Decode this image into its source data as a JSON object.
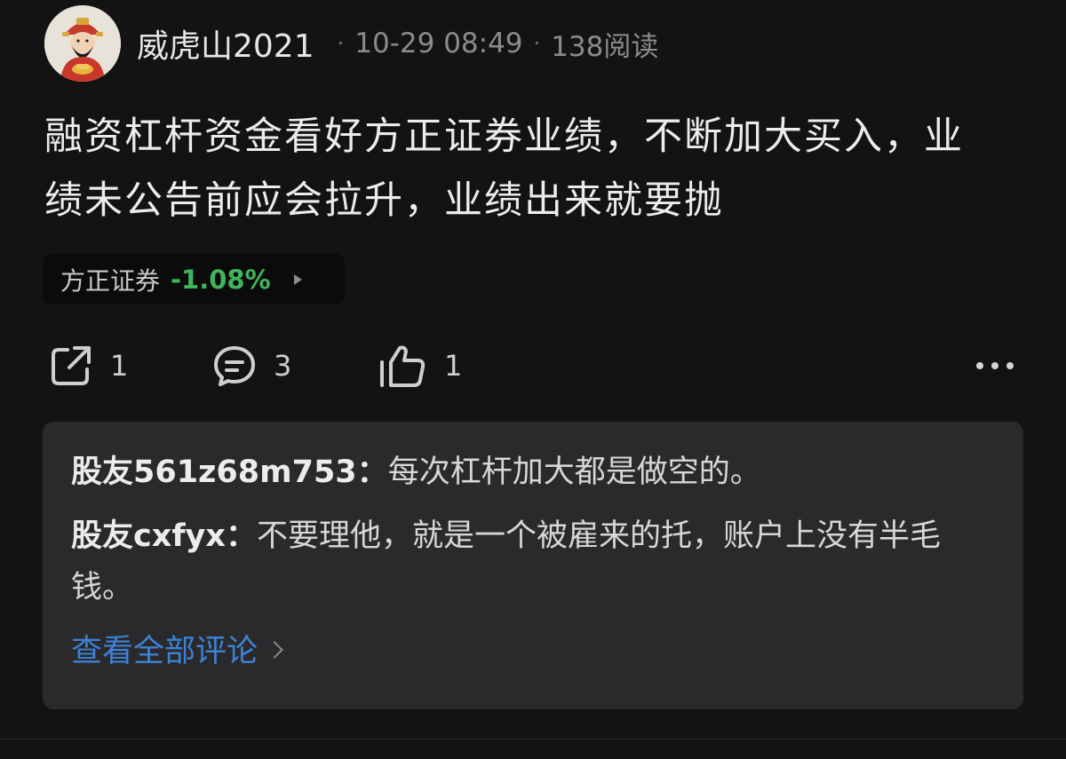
{
  "post": {
    "author": "威虎山2021",
    "time": "10-29 08:49",
    "reads": "138阅读",
    "separator": "·",
    "content": "融资杠杆资金看好方正证券业绩，不断加大买入，业绩未公告前应会拉升，业绩出来就要抛"
  },
  "stock": {
    "name": "方正证券",
    "change": "-1.08%",
    "change_color": "#3fb45a"
  },
  "actions": {
    "share_icon": "share-icon",
    "share_count": "1",
    "comment_icon": "comment-icon",
    "comment_count": "3",
    "like_icon": "thumbs-up-icon",
    "like_count": "1",
    "more_icon": "more-icon"
  },
  "comments": {
    "items": [
      {
        "author": "股友561z68m753",
        "colon": "：",
        "text": "每次杠杆加大都是做空的。"
      },
      {
        "author": "股友cxfyx",
        "colon": "：",
        "text": "不要理他，就是一个被雇来的托，账户上没有半毛钱。"
      }
    ],
    "view_all": "查看全部评论",
    "link_color": "#3d82d6"
  }
}
